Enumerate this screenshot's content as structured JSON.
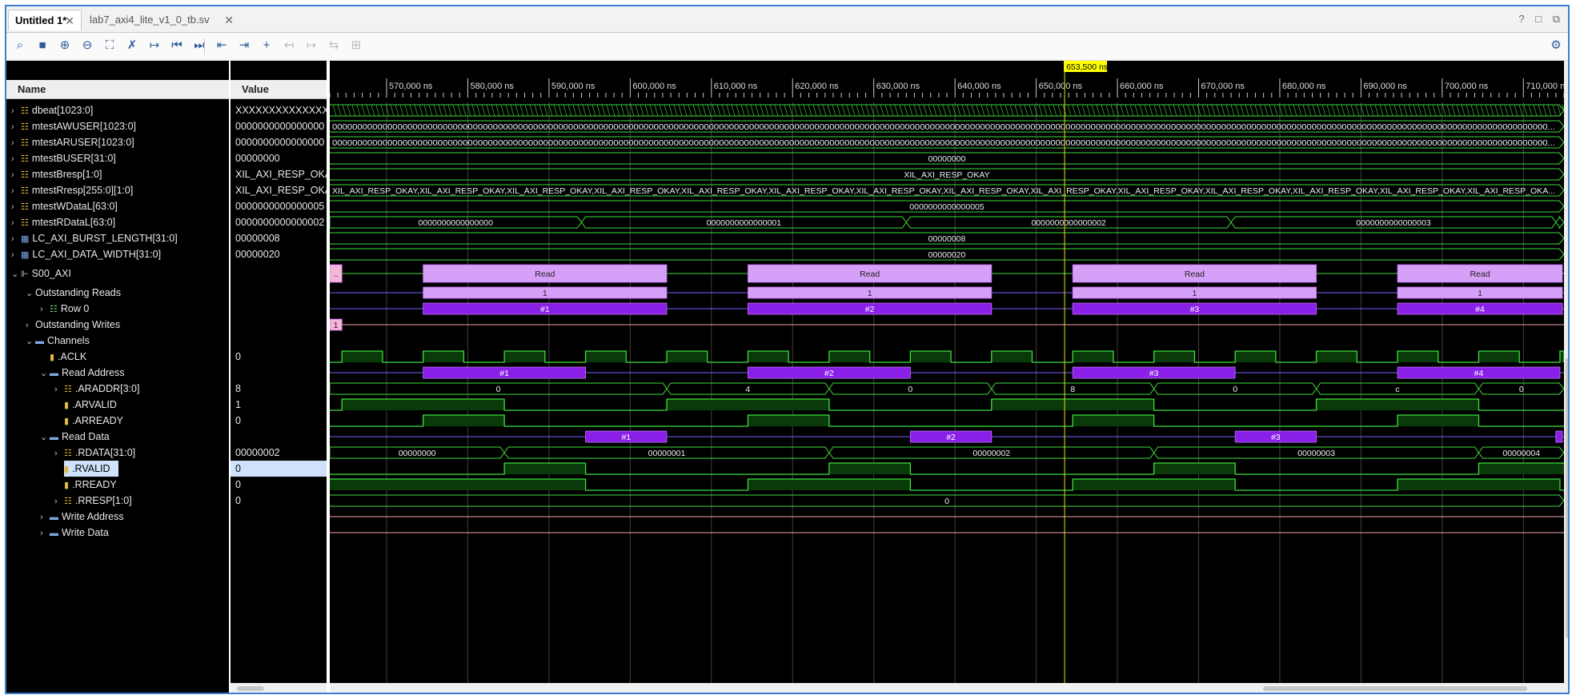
{
  "tabs": [
    {
      "label": "Untitled 1*",
      "active": true
    },
    {
      "label": "lab7_axi4_lite_v1_0_tb.sv",
      "active": false
    }
  ],
  "window_controls": [
    "?",
    "□",
    "⧉"
  ],
  "toolbar": [
    {
      "name": "search-icon",
      "glyph": "⌕"
    },
    {
      "name": "save-icon",
      "glyph": "■"
    },
    {
      "name": "zoom-in-icon",
      "glyph": "⊕"
    },
    {
      "name": "zoom-out-icon",
      "glyph": "⊖"
    },
    {
      "name": "zoom-fit-icon",
      "glyph": "⛶"
    },
    {
      "name": "cursor-off-icon",
      "glyph": "✗"
    },
    {
      "name": "go-to-cursor-icon",
      "glyph": "↦"
    },
    {
      "name": "go-to-start-icon",
      "glyph": "⏮"
    },
    {
      "name": "go-to-end-icon",
      "glyph": "⏭"
    },
    {
      "name": "previous-transition-icon",
      "glyph": "⇤"
    },
    {
      "name": "next-transition-icon",
      "glyph": "⇥"
    },
    {
      "name": "add-marker-icon",
      "glyph": "+"
    },
    {
      "name": "previous-marker-icon",
      "glyph": "↤",
      "disabled": true
    },
    {
      "name": "next-marker-icon",
      "glyph": "↦",
      "disabled": true
    },
    {
      "name": "swap-cursors-icon",
      "glyph": "⇆",
      "disabled": true
    },
    {
      "name": "snap-icon",
      "glyph": "⊞",
      "disabled": true
    }
  ],
  "headers": {
    "name": "Name",
    "value": "Value"
  },
  "cursor": {
    "label": "653,500 ns",
    "time": 653500
  },
  "timeline": {
    "start": 563000,
    "end": 715000,
    "major": 10000,
    "minor": 1000,
    "labels": [
      "570,000 ns",
      "580,000 ns",
      "590,000 ns",
      "600,000 ns",
      "610,000 ns",
      "620,000 ns",
      "630,000 ns",
      "640,000 ns",
      "650,000 ns",
      "660,000 ns",
      "670,000 ns",
      "680,000 ns",
      "690,000 ns",
      "700,000 ns",
      "710,000 ns"
    ]
  },
  "colors": {
    "signal": "#3cdc3c",
    "busfill": "#0a3a0a",
    "txn_light": "#d7a0f8",
    "txn_dark": "#8a1fe8",
    "cursor": "#e6e600",
    "cursor_label_bg": "#ffff00",
    "grid": "#404040",
    "selection": "#cfe2fb"
  },
  "signals": [
    {
      "name": "dbeat[1023:0]",
      "value": "XXXXXXXXXXXXXXXX",
      "depth": 0,
      "chev": "right",
      "icon": "bus",
      "type": "xbus",
      "text": ""
    },
    {
      "name": "mtestAWUSER[1023:0]",
      "value": "0000000000000000",
      "depth": 0,
      "chev": "right",
      "icon": "bus",
      "type": "bus",
      "text": "00000000000000000000000000000000000000000000000000000000000000000000000000000000000000000000000000000000000000000000000000000000000000000000000000000000000000000000000000000000000000000000000000000000000000000000000000000000000000000000000000..."
    },
    {
      "name": "mtestARUSER[1023:0]",
      "value": "0000000000000000",
      "depth": 0,
      "chev": "right",
      "icon": "bus",
      "type": "bus",
      "text": "00000000000000000000000000000000000000000000000000000000000000000000000000000000000000000000000000000000000000000000000000000000000000000000000000000000000000000000000000000000000000000000000000000000000000000000000000000000000000000000000000..."
    },
    {
      "name": "mtestBUSER[31:0]",
      "value": "00000000",
      "depth": 0,
      "chev": "right",
      "icon": "bus",
      "type": "bus",
      "text": "00000000"
    },
    {
      "name": "mtestBresp[1:0]",
      "value": "XIL_AXI_RESP_OKAY",
      "depth": 0,
      "chev": "right",
      "icon": "bus",
      "type": "bus",
      "text": "XIL_AXI_RESP_OKAY"
    },
    {
      "name": "mtestRresp[255:0][1:0]",
      "value": "XIL_AXI_RESP_OKAY",
      "depth": 0,
      "chev": "right",
      "icon": "bus",
      "type": "bus",
      "text": "XIL_AXI_RESP_OKAY,XIL_AXI_RESP_OKAY,XIL_AXI_RESP_OKAY,XIL_AXI_RESP_OKAY,XIL_AXI_RESP_OKAY,XIL_AXI_RESP_OKAY,XIL_AXI_RESP_OKAY,XIL_AXI_RESP_OKAY,XIL_AXI_RESP_OKAY,XIL_AXI_RESP_OKAY,XIL_AXI_RESP_OKAY,XIL_AXI_RESP_OKAY,XIL_AXI_RESP_OKAY,XIL_AXI_RESP_OKA..."
    },
    {
      "name": "mtestWDataL[63:0]",
      "value": "0000000000000005",
      "depth": 0,
      "chev": "right",
      "icon": "bus",
      "type": "bus",
      "text": "0000000000000005"
    },
    {
      "name": "mtestRDataL[63:0]",
      "value": "0000000000000002",
      "depth": 0,
      "chev": "right",
      "icon": "bus",
      "type": "segbus",
      "segments": [
        {
          "t0": 563000,
          "t1": 594000,
          "text": "0000000000000000"
        },
        {
          "t0": 594000,
          "t1": 634000,
          "text": "0000000000000001"
        },
        {
          "t0": 634000,
          "t1": 674000,
          "text": "0000000000000002"
        },
        {
          "t0": 674000,
          "t1": 714000,
          "text": "0000000000000003"
        },
        {
          "t0": 714000,
          "t1": 715000,
          "text": ""
        }
      ]
    },
    {
      "name": "LC_AXI_BURST_LENGTH[31:0]",
      "value": "00000008",
      "depth": 0,
      "chev": "right",
      "icon": "param",
      "type": "bus",
      "text": "00000008"
    },
    {
      "name": "LC_AXI_DATA_WIDTH[31:0]",
      "value": "00000020",
      "depth": 0,
      "chev": "right",
      "icon": "param",
      "type": "bus",
      "text": "00000020"
    },
    {
      "name": "S00_AXI",
      "value": "",
      "depth": 0,
      "chev": "down",
      "icon": "iface",
      "type": "txn",
      "tall": true,
      "linecolor": "#3cdc3c",
      "boxes": [
        {
          "t0": 563000,
          "t1": 564500,
          "text": "..",
          "color": "#f4b6d8"
        },
        {
          "t0": 574500,
          "t1": 604500,
          "text": "Read",
          "color": "#d7a0f8"
        },
        {
          "t0": 614500,
          "t1": 644500,
          "text": "Read",
          "color": "#d7a0f8"
        },
        {
          "t0": 654500,
          "t1": 684500,
          "text": "Read",
          "color": "#d7a0f8"
        },
        {
          "t0": 694500,
          "t1": 715000,
          "text": "Read",
          "color": "#d7a0f8"
        }
      ]
    },
    {
      "name": "Outstanding Reads",
      "value": "",
      "depth": 1,
      "chev": "down",
      "icon": "none",
      "type": "txn",
      "linecolor": "#7a5cff",
      "boxes": [
        {
          "t0": 574500,
          "t1": 604500,
          "text": "1",
          "color": "#d7a0f8"
        },
        {
          "t0": 614500,
          "t1": 644500,
          "text": "1",
          "color": "#d7a0f8"
        },
        {
          "t0": 654500,
          "t1": 684500,
          "text": "1",
          "color": "#d7a0f8"
        },
        {
          "t0": 694500,
          "t1": 715000,
          "text": "1",
          "color": "#d7a0f8"
        }
      ]
    },
    {
      "name": "Row 0",
      "value": "",
      "depth": 2,
      "chev": "right",
      "icon": "row",
      "type": "txn",
      "linecolor": "#7a5cff",
      "textcolor": "#ffffff",
      "boxes": [
        {
          "t0": 574500,
          "t1": 604500,
          "text": "#1",
          "color": "#8a1fe8"
        },
        {
          "t0": 614500,
          "t1": 644500,
          "text": "#2",
          "color": "#8a1fe8"
        },
        {
          "t0": 654500,
          "t1": 684500,
          "text": "#3",
          "color": "#8a1fe8"
        },
        {
          "t0": 694500,
          "t1": 715000,
          "text": "#4",
          "color": "#8a1fe8"
        }
      ]
    },
    {
      "name": "Outstanding Writes",
      "value": "",
      "depth": 1,
      "chev": "right",
      "icon": "none",
      "type": "txn",
      "linecolor": "#f4a0a0",
      "boxes": [
        {
          "t0": 563000,
          "t1": 564500,
          "text": "1",
          "color": "#f4b6d8"
        }
      ]
    },
    {
      "name": "Channels",
      "value": "",
      "depth": 1,
      "chev": "down",
      "icon": "group",
      "type": "none"
    },
    {
      "name": ".ACLK",
      "value": "0",
      "depth": 2,
      "chev": "none",
      "icon": "wire",
      "type": "clock",
      "period": 10000,
      "first_rise": 564500
    },
    {
      "name": "Read Address",
      "value": "",
      "depth": 2,
      "chev": "down",
      "icon": "group",
      "type": "txn",
      "linecolor": "#7a5cff",
      "textcolor": "#ffffff",
      "boxes": [
        {
          "t0": 574500,
          "t1": 594500,
          "text": "#1",
          "color": "#8a1fe8"
        },
        {
          "t0": 614500,
          "t1": 634500,
          "text": "#2",
          "color": "#8a1fe8"
        },
        {
          "t0": 654500,
          "t1": 674500,
          "text": "#3",
          "color": "#8a1fe8"
        },
        {
          "t0": 694500,
          "t1": 714500,
          "text": "#4",
          "color": "#8a1fe8"
        }
      ]
    },
    {
      "name": ".ARADDR[3:0]",
      "value": "8",
      "depth": 3,
      "chev": "right",
      "icon": "bus",
      "type": "segbus",
      "segments": [
        {
          "t0": 563000,
          "t1": 604500,
          "text": "0"
        },
        {
          "t0": 604500,
          "t1": 624500,
          "text": "4"
        },
        {
          "t0": 624500,
          "t1": 644500,
          "text": "0"
        },
        {
          "t0": 644500,
          "t1": 664500,
          "text": "8"
        },
        {
          "t0": 664500,
          "t1": 684500,
          "text": "0"
        },
        {
          "t0": 684500,
          "t1": 704500,
          "text": "c"
        },
        {
          "t0": 704500,
          "t1": 715000,
          "text": "0"
        }
      ]
    },
    {
      "name": ".ARVALID",
      "value": "1",
      "depth": 3,
      "chev": "none",
      "icon": "wire",
      "type": "wire",
      "highs": [
        [
          564500,
          584500
        ],
        [
          604500,
          624500
        ],
        [
          644500,
          664500
        ],
        [
          684500,
          704500
        ]
      ]
    },
    {
      "name": ".ARREADY",
      "value": "0",
      "depth": 3,
      "chev": "none",
      "icon": "wire",
      "type": "wire",
      "highs": [
        [
          574500,
          584500
        ],
        [
          614500,
          624500
        ],
        [
          654500,
          664500
        ],
        [
          694500,
          704500
        ]
      ]
    },
    {
      "name": "Read Data",
      "value": "",
      "depth": 2,
      "chev": "down",
      "icon": "group",
      "type": "txn",
      "linecolor": "#7a5cff",
      "textcolor": "#ffffff",
      "boxes": [
        {
          "t0": 594500,
          "t1": 604500,
          "text": "#1",
          "color": "#8a1fe8"
        },
        {
          "t0": 634500,
          "t1": 644500,
          "text": "#2",
          "color": "#8a1fe8"
        },
        {
          "t0": 674500,
          "t1": 684500,
          "text": "#3",
          "color": "#8a1fe8"
        },
        {
          "t0": 714000,
          "t1": 715000,
          "text": "",
          "color": "#8a1fe8"
        }
      ]
    },
    {
      "name": ".RDATA[31:0]",
      "value": "00000002",
      "depth": 3,
      "chev": "right",
      "icon": "bus",
      "type": "segbus",
      "segments": [
        {
          "t0": 563000,
          "t1": 584500,
          "text": "00000000"
        },
        {
          "t0": 584500,
          "t1": 624500,
          "text": "00000001"
        },
        {
          "t0": 624500,
          "t1": 664500,
          "text": "00000002"
        },
        {
          "t0": 664500,
          "t1": 704500,
          "text": "00000003"
        },
        {
          "t0": 704500,
          "t1": 715000,
          "text": "00000004"
        }
      ]
    },
    {
      "name": ".RVALID",
      "value": "0",
      "depth": 3,
      "chev": "none",
      "icon": "wire",
      "type": "wire",
      "selected": true,
      "highs": [
        [
          584500,
          594500
        ],
        [
          624500,
          634500
        ],
        [
          664500,
          674500
        ],
        [
          704500,
          715000
        ]
      ]
    },
    {
      "name": ".RREADY",
      "value": "0",
      "depth": 3,
      "chev": "none",
      "icon": "wire",
      "type": "wire",
      "highs": [
        [
          563000,
          594500
        ],
        [
          614500,
          634500
        ],
        [
          654500,
          674500
        ],
        [
          694500,
          714500
        ]
      ]
    },
    {
      "name": ".RRESP[1:0]",
      "value": "0",
      "depth": 3,
      "chev": "right",
      "icon": "bus",
      "type": "bus",
      "text": "0"
    },
    {
      "name": "Write Address",
      "value": "",
      "depth": 2,
      "chev": "right",
      "icon": "group",
      "type": "line",
      "linecolor": "#f4a0a0"
    },
    {
      "name": "Write Data",
      "value": "",
      "depth": 2,
      "chev": "right",
      "icon": "group",
      "type": "line",
      "linecolor": "#f4a0a0"
    }
  ]
}
